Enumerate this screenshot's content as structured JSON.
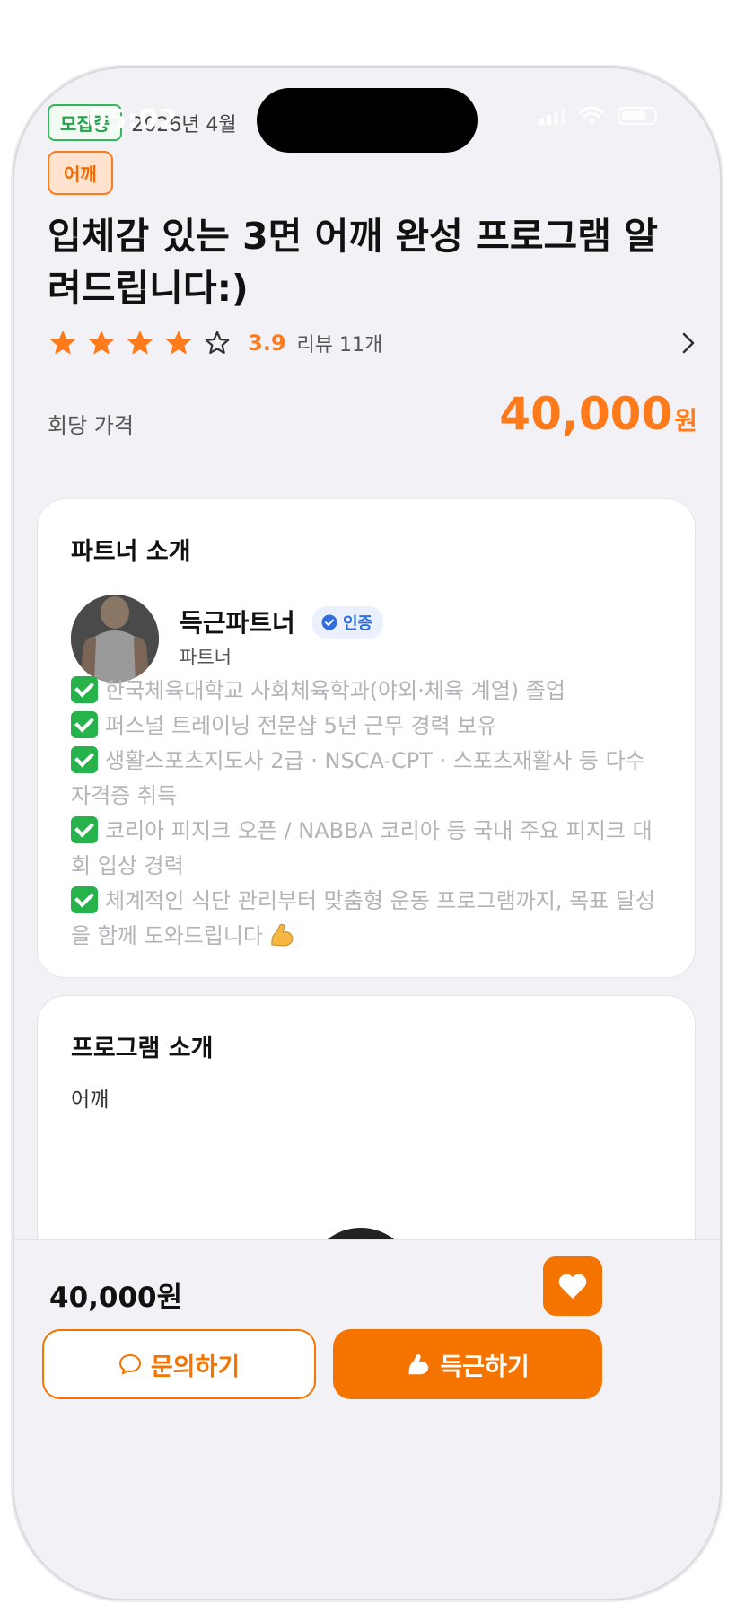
{
  "status_bar": {
    "time": "05:02"
  },
  "header": {
    "recruit_badge": "모집중",
    "date": "2026년 4월",
    "category_badge": "어깨",
    "title": "입체감 있는 3면 어깨 완성 프로그램 알려드립니다:)"
  },
  "rating": {
    "score": "3.9",
    "stars": 4,
    "max_stars": 5,
    "review_text": "리뷰 11개"
  },
  "price": {
    "label": "회당 가격",
    "amount": "40,000",
    "unit": "원"
  },
  "partner_card": {
    "title": "파트너 소개",
    "name": "득근파트너",
    "verified_label": "인증",
    "role": "파트너",
    "intro": [
      "한국체육대학교 사회체육학과(야외·체육 계열) 졸업",
      "퍼스널 트레이닝 전문샵 5년 근무 경력 보유",
      "생활스포츠지도사 2급 · NSCA-CPT · 스포츠재활사 등 다수 자격증 취득",
      "코리아 피지크 오픈 / NABBA 코리아 등 국내 주요 피지크 대회 입상 경력",
      "체계적인 식단 관리부터 맞춤형 운동 프로그램까지, 목표 달성을 함께 도와드립니다"
    ]
  },
  "program_card": {
    "title": "프로그램 소개",
    "subtitle": "어깨"
  },
  "bottom_bar": {
    "price": "40,000원",
    "ask_button": "문의하기",
    "join_button": "득근하기"
  },
  "colors": {
    "accent": "#f57400",
    "rating": "#ff7a1a",
    "verified": "#2f6ee0",
    "check": "#27b34b"
  }
}
